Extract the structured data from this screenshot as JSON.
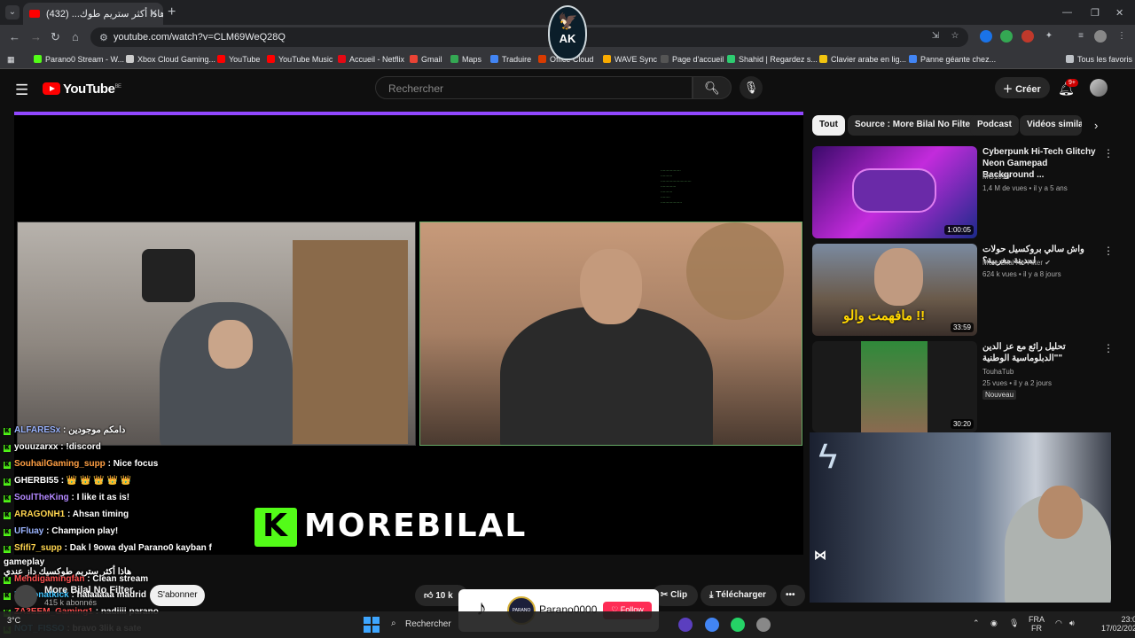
{
  "browser": {
    "tab_title": "هاذا أكثر ستريم طوك... (432)",
    "new_tab": "+",
    "url": "youtube.com/watch?v=CLM69WeQ28Q",
    "bookmarks": [
      {
        "label": "Parano0 Stream - W...",
        "color": "#53fc18"
      },
      {
        "label": "Xbox Cloud Gaming...",
        "color": "#cccccc"
      },
      {
        "label": "YouTube",
        "color": "#ff0000"
      },
      {
        "label": "YouTube Music",
        "color": "#ff0000"
      },
      {
        "label": "Accueil - Netflix",
        "color": "#e50914"
      },
      {
        "label": "Gmail",
        "color": "#ea4335"
      },
      {
        "label": "Maps",
        "color": "#34a853"
      },
      {
        "label": "Traduire",
        "color": "#4285f4"
      },
      {
        "label": "Office Cloud",
        "color": "#d83b01"
      },
      {
        "label": "WAVE Sync",
        "color": "#f9ab00"
      },
      {
        "label": "Page d'accueil",
        "color": "#555555"
      },
      {
        "label": "Shahid | Regardez s...",
        "color": "#2ecc71"
      },
      {
        "label": "Clavier arabe en lig...",
        "color": "#f1c40f"
      },
      {
        "label": "Panne géante chez...",
        "color": "#4285f4"
      }
    ],
    "all_bookmarks": "Tous les favoris"
  },
  "overlay_logo": {
    "text": "AK"
  },
  "youtube": {
    "logo_text": "YouTube",
    "logo_region": "BE",
    "search_placeholder": "Rechercher",
    "create_label": "Créer",
    "notification_count": "9+"
  },
  "player": {
    "brandmark": "MOREBILAL",
    "brand_k": "K",
    "chat": [
      {
        "user": "ALFARESx",
        "msg": "دامكم موجودين",
        "color": "#9bb4ff"
      },
      {
        "user": "youuzarxx",
        "msg": "!discord",
        "color": "#ffffff"
      },
      {
        "user": "SouhailGaming_supp",
        "msg": "Nice focus",
        "color": "#ff9f43"
      },
      {
        "user": "GHERBI55",
        "msg": "👑 👑 👑 👑 👑",
        "color": "#ffffff"
      },
      {
        "user": "SoulTheKing",
        "msg": "I like it as is!",
        "color": "#b388ff"
      },
      {
        "user": "ARAGONH1",
        "msg": "Ahsan timing",
        "color": "#ffd54f"
      },
      {
        "user": "UFluay",
        "msg": "Champion play!",
        "color": "#9bb4ff"
      },
      {
        "user": "Sfifi7_supp",
        "msg": "Dak l 9owa dyal Parano0 kayban f",
        "color": "#ffd54f"
      },
      {
        "user": "",
        "msg": "gameplay",
        "color": "#ffffff"
      },
      {
        "user": "",
        "msg": "هاذا أكثر ستريم طوكسيك داز عندي",
        "color": "#ffffff"
      },
      {
        "user": "Mehdigamingfan",
        "msg": "Clean stream",
        "color": "#ff5252"
      },
      {
        "user": "Dissonatkick",
        "msg": "halaaaaa madrid",
        "color": "#40c4ff"
      },
      {
        "user": "ZA3EEM_Gaming1",
        "msg": "nadiiii parano",
        "color": "#ff5252"
      },
      {
        "user": "NOT_FISSO",
        "msg": "bravo 3lik a sate",
        "color": "#40c4ff"
      }
    ]
  },
  "below_player": {
    "channel_name": "More Bilal No Filter",
    "subscribers": "415 k abonnés",
    "subscribe_label": "S'abonner",
    "like_count": "10 k",
    "clip_label": "Clip",
    "download_label": "Télécharger",
    "more_label": "•••"
  },
  "sidebar": {
    "chips": [
      "Tout",
      "Source : More Bilal No Filter",
      "Podcast",
      "Vidéos similai"
    ],
    "videos": [
      {
        "title": "Cyberpunk Hi-Tech Glitchy Neon Gamepad Background ...",
        "channel": "MG1010",
        "meta": "1,4 M de vues • il y a 5 ans",
        "duration": "1:00:05",
        "badge": ""
      },
      {
        "title": "واش سالي بروكسيل حولات لمدينة مغربية؟",
        "channel": "More Bilal No Filter",
        "meta": "624 k vues • il y a 8 jours",
        "duration": "33:59",
        "badge": "",
        "thumb_text": "مافهمت والو !!"
      },
      {
        "title": "تحليل رائع مع عز الدين \"الدبلوماسية الوطنية\"",
        "channel": "TouhaTub",
        "meta": "25 vues • il y a 2 jours",
        "duration": "30:20",
        "badge": "Nouveau"
      }
    ]
  },
  "tiktok_overlay": {
    "logo": "♪",
    "username": "Parano0000",
    "avatar_text": "PARANO",
    "follow_label": "Follow"
  },
  "taskbar": {
    "search_label": "Rechercher",
    "weather": "3°C",
    "lang_top": "FRA",
    "lang_bottom": "FR",
    "time": "23:09",
    "date": "17/02/2026"
  }
}
